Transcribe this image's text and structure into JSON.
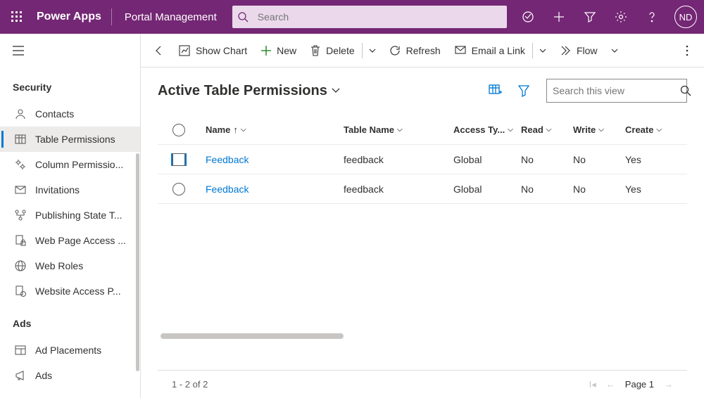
{
  "header": {
    "brand": "Power Apps",
    "portal": "Portal Management",
    "search_placeholder": "Search",
    "avatar_initials": "ND"
  },
  "sidebar": {
    "groups": [
      {
        "label": "Security",
        "items": [
          {
            "label": "Contacts",
            "active": false,
            "icon": "person"
          },
          {
            "label": "Table Permissions",
            "active": true,
            "icon": "table"
          },
          {
            "label": "Column Permissio...",
            "active": false,
            "icon": "gear-grid"
          },
          {
            "label": "Invitations",
            "active": false,
            "icon": "mail"
          },
          {
            "label": "Publishing State T...",
            "active": false,
            "icon": "flow-tree"
          },
          {
            "label": "Web Page Access ...",
            "active": false,
            "icon": "page-lock"
          },
          {
            "label": "Web Roles",
            "active": false,
            "icon": "globe"
          },
          {
            "label": "Website Access P...",
            "active": false,
            "icon": "page-globe"
          }
        ]
      },
      {
        "label": "Ads",
        "items": [
          {
            "label": "Ad Placements",
            "active": false,
            "icon": "layout"
          },
          {
            "label": "Ads",
            "active": false,
            "icon": "megaphone"
          }
        ]
      }
    ]
  },
  "cmdbar": {
    "show_chart": "Show Chart",
    "new": "New",
    "delete": "Delete",
    "refresh": "Refresh",
    "email_link": "Email a Link",
    "flow": "Flow"
  },
  "view": {
    "title": "Active Table Permissions",
    "search_placeholder": "Search this view"
  },
  "grid": {
    "columns": {
      "name": "Name",
      "table_name": "Table Name",
      "access_type": "Access Ty...",
      "read": "Read",
      "write": "Write",
      "create": "Create"
    },
    "rows": [
      {
        "name": "Feedback",
        "table_name": "feedback",
        "access_type": "Global",
        "read": "No",
        "write": "No",
        "create": "Yes",
        "selected": true
      },
      {
        "name": "Feedback",
        "table_name": "feedback",
        "access_type": "Global",
        "read": "No",
        "write": "No",
        "create": "Yes",
        "selected": false
      }
    ]
  },
  "footer": {
    "range": "1 - 2 of 2",
    "page_label": "Page 1"
  }
}
